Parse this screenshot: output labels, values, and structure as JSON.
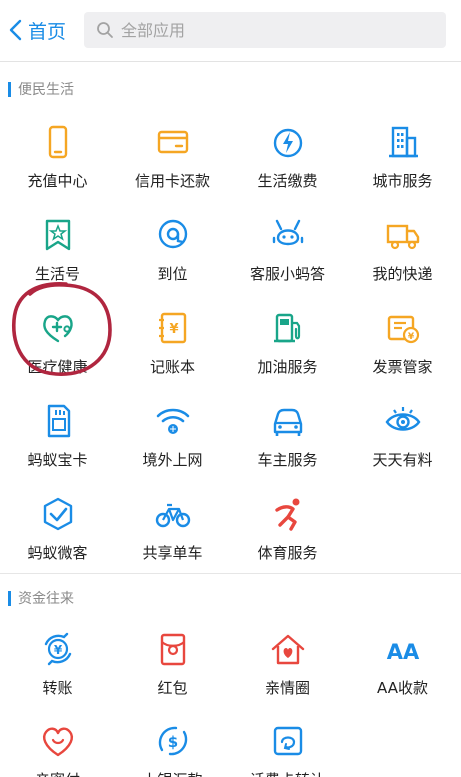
{
  "header": {
    "back_label": "首页",
    "search_placeholder": "全部应用"
  },
  "sections": [
    {
      "title": "便民生活",
      "items": [
        {
          "label": "充值中心",
          "icon": "phone-icon",
          "color": "#f5a623"
        },
        {
          "label": "信用卡还款",
          "icon": "credit-card-icon",
          "color": "#f5a623"
        },
        {
          "label": "生活缴费",
          "icon": "utility-bolt-icon",
          "color": "#1a8ce6"
        },
        {
          "label": "城市服务",
          "icon": "city-building-icon",
          "color": "#1a8ce6"
        },
        {
          "label": "生活号",
          "icon": "bookmark-star-icon",
          "color": "#19a589"
        },
        {
          "label": "到位",
          "icon": "location-pin-icon",
          "color": "#1a8ce6"
        },
        {
          "label": "客服小蚂答",
          "icon": "ant-service-icon",
          "color": "#1a8ce6"
        },
        {
          "label": "我的快递",
          "icon": "delivery-truck-icon",
          "color": "#f5a623"
        },
        {
          "label": "医疗健康",
          "icon": "medical-stethoscope-icon",
          "color": "#19a589"
        },
        {
          "label": "记账本",
          "icon": "account-book-icon",
          "color": "#f5a623"
        },
        {
          "label": "加油服务",
          "icon": "fuel-pump-icon",
          "color": "#19a589"
        },
        {
          "label": "发票管家",
          "icon": "invoice-icon",
          "color": "#f5a623"
        },
        {
          "label": "蚂蚁宝卡",
          "icon": "sim-card-icon",
          "color": "#1a8ce6"
        },
        {
          "label": "境外上网",
          "icon": "wifi-globe-icon",
          "color": "#1a8ce6"
        },
        {
          "label": "车主服务",
          "icon": "car-icon",
          "color": "#1a8ce6"
        },
        {
          "label": "天天有料",
          "icon": "eye-icon",
          "color": "#1a8ce6"
        },
        {
          "label": "蚂蚁微客",
          "icon": "hexagon-check-icon",
          "color": "#1a8ce6"
        },
        {
          "label": "共享单车",
          "icon": "bicycle-icon",
          "color": "#1a8ce6"
        },
        {
          "label": "体育服务",
          "icon": "running-figure-icon",
          "color": "#e8473e"
        }
      ]
    },
    {
      "title": "资金往来",
      "items": [
        {
          "label": "转账",
          "icon": "transfer-yuan-icon",
          "color": "#1a8ce6"
        },
        {
          "label": "红包",
          "icon": "red-envelope-icon",
          "color": "#e8473e"
        },
        {
          "label": "亲情圈",
          "icon": "family-house-icon",
          "color": "#e8473e"
        },
        {
          "label": "AA收款",
          "icon": "aa-icon",
          "color": "#1a8ce6"
        },
        {
          "label": "亲密付",
          "icon": "heart-icon",
          "color": "#e8473e"
        },
        {
          "label": "上银汇款",
          "icon": "dollar-swirl-icon",
          "color": "#1a8ce6"
        },
        {
          "label": "话费卡转让",
          "icon": "card-transfer-icon",
          "color": "#1a8ce6"
        }
      ]
    }
  ]
}
